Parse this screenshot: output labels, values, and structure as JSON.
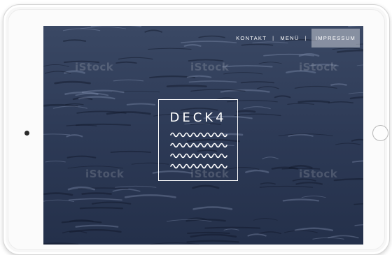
{
  "nav": {
    "items": [
      {
        "label": "KONTAKT",
        "active": false
      },
      {
        "label": "MENÜ",
        "active": false
      },
      {
        "label": "IMPRESSUM",
        "active": true
      }
    ],
    "separator": "|"
  },
  "logo": {
    "text": "DECK4",
    "wave_rows": 4
  },
  "watermark": {
    "text": "iStock"
  },
  "colors": {
    "ocean_dark": "#26324b",
    "ocean_mid": "#3a4a68",
    "ocean_light": "#5d6e8e",
    "text": "#ffffff",
    "active_nav_bg": "#c8ccd6"
  }
}
